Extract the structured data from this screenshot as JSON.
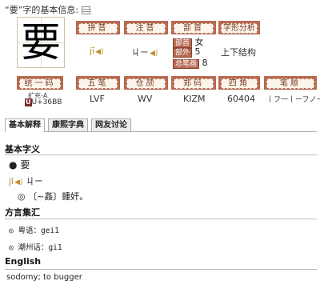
{
  "header": {
    "title": "“要”字的基本信息:"
  },
  "char": {
    "glyph": "要"
  },
  "labels": {
    "pinyin": "拼音",
    "zhuyin": "注音",
    "bushou": "部首",
    "zixing": "字形分析",
    "tongyima": "统一码",
    "wubi": "五笔",
    "cangjie": "仓颉",
    "zhengma": "郑码",
    "sijiao": "四角",
    "bishun": "笔顺"
  },
  "values": {
    "pinyin": "jī",
    "zhuyin": "ㄐㄧ",
    "bushou_tag": "部首",
    "bushou_val": "女",
    "buwai_tag": "部外",
    "buwai_val": "5",
    "zongbihua_tag": "总笔画",
    "zongbihua_val": "8",
    "zixing": "上下结构",
    "ext": "扩充-A",
    "unicode": "U+36BB",
    "wubi": "LVF",
    "cangjie": "WV",
    "zhengma": "KIZM",
    "sijiao": "60404",
    "bishun": "丨フ一丨ーフノー"
  },
  "tabs": [
    "基本解释",
    "康熙字典",
    "网友讨论"
  ],
  "content": {
    "basic_title": "基本字义",
    "bullet_char": "要",
    "pinyin2": "jī",
    "zhuyin2": "ㄐㄧ",
    "def1": "◎ 〔~姦〕鍾奸。",
    "dialect_title": "方言集汇",
    "dialect1": "◎ 粤语：gei1",
    "dialect2": "◎ 潮州话：gi1",
    "english_title": "English",
    "english": "sodomy; to bugger"
  },
  "colors": {
    "label_bg": "#b76a52",
    "label_text": "#7a3a24",
    "accent": "#c08a2a"
  }
}
